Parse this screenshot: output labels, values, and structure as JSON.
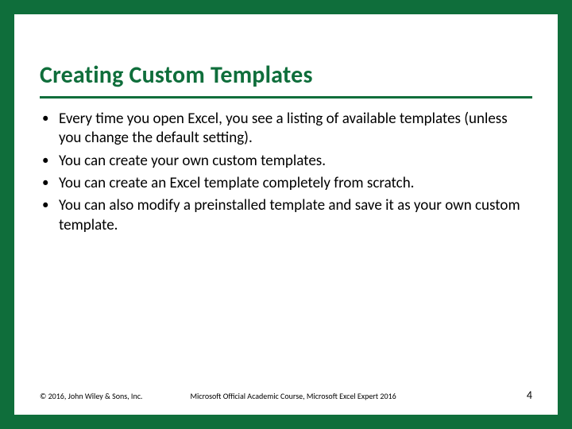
{
  "title": "Creating Custom Templates",
  "bullets": [
    "Every time you open Excel, you see a listing of available templates (unless you change the default setting).",
    "You can create your own custom templates.",
    "You can create an Excel template completely from scratch.",
    "You can also modify a preinstalled template and save it as your own custom template."
  ],
  "footer": {
    "copyright": "© 2016, John Wiley & Sons, Inc.",
    "course": "Microsoft Official Academic Course, Microsoft Excel Expert 2016",
    "page": "4"
  },
  "colors": {
    "brand": "#0f6e3b"
  }
}
